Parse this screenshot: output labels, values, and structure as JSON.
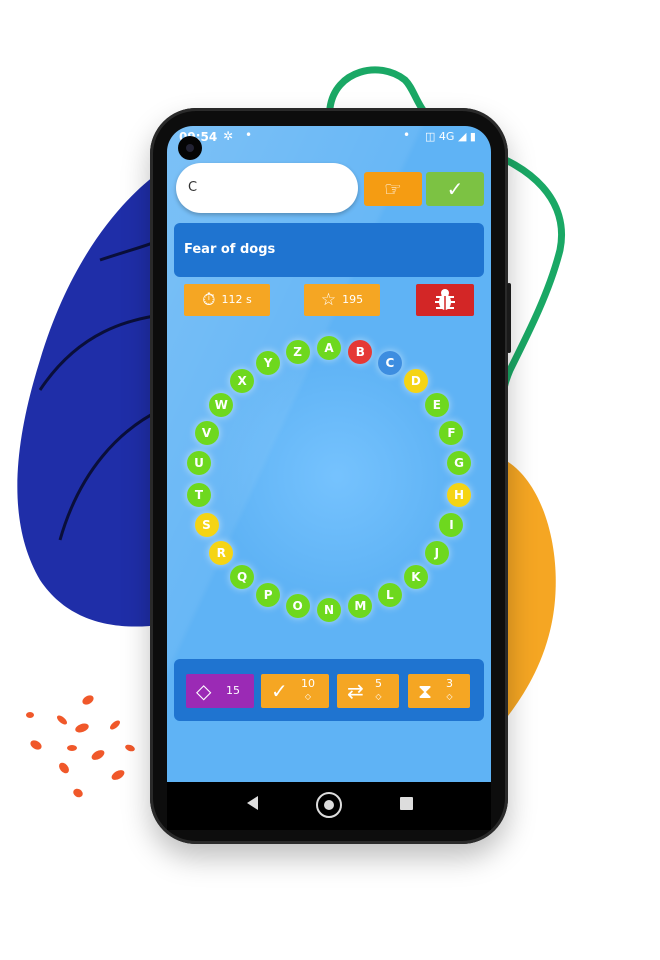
{
  "colors": {
    "screen_bg": "#5fb3f5",
    "panel_blue": "#1f74d0",
    "orange": "#f59c12",
    "green": "#7cc243",
    "red": "#d32626",
    "purple": "#9b2ab5",
    "letter_green": "#6ed81e",
    "letter_red": "#e53935",
    "letter_blue": "#3d8de0",
    "letter_yellow": "#f5d414"
  },
  "status_bar": {
    "time": "09:54",
    "left_icons": [
      "fan-icon",
      "dot"
    ],
    "right_icons": [
      "vibrate-icon",
      "network-4g",
      "signal-icon",
      "battery-icon"
    ],
    "network_label": "4G"
  },
  "answer_input": {
    "value": "C"
  },
  "hint_button": {
    "icon": "pointing-hand-icon"
  },
  "submit_button": {
    "icon": "check-icon"
  },
  "question": {
    "text": "Fear of dogs"
  },
  "stats": {
    "timer": {
      "icon": "stopwatch-icon",
      "value": "112 s"
    },
    "score": {
      "icon": "star-outline-icon",
      "value": "195"
    },
    "report": {
      "icon": "bug-icon"
    }
  },
  "letter_wheel": [
    {
      "letter": "A",
      "state": "default"
    },
    {
      "letter": "B",
      "state": "wrong"
    },
    {
      "letter": "C",
      "state": "current"
    },
    {
      "letter": "D",
      "state": "pending"
    },
    {
      "letter": "E",
      "state": "default"
    },
    {
      "letter": "F",
      "state": "default"
    },
    {
      "letter": "G",
      "state": "default"
    },
    {
      "letter": "H",
      "state": "pending"
    },
    {
      "letter": "I",
      "state": "default"
    },
    {
      "letter": "J",
      "state": "default"
    },
    {
      "letter": "K",
      "state": "default"
    },
    {
      "letter": "L",
      "state": "default"
    },
    {
      "letter": "M",
      "state": "default"
    },
    {
      "letter": "N",
      "state": "default"
    },
    {
      "letter": "O",
      "state": "default"
    },
    {
      "letter": "P",
      "state": "default"
    },
    {
      "letter": "Q",
      "state": "default"
    },
    {
      "letter": "R",
      "state": "pending"
    },
    {
      "letter": "S",
      "state": "pending"
    },
    {
      "letter": "T",
      "state": "default"
    },
    {
      "letter": "U",
      "state": "default"
    },
    {
      "letter": "V",
      "state": "default"
    },
    {
      "letter": "W",
      "state": "default"
    },
    {
      "letter": "X",
      "state": "default"
    },
    {
      "letter": "Y",
      "state": "default"
    },
    {
      "letter": "Z",
      "state": "default"
    }
  ],
  "powerups": {
    "gems": {
      "icon": "diamond-icon",
      "value": "15"
    },
    "reveal": {
      "icon": "check-icon",
      "cost": "10"
    },
    "swap": {
      "icon": "swap-arrows-icon",
      "cost": "5"
    },
    "time": {
      "icon": "hourglass-icon",
      "cost": "3"
    }
  },
  "nav_bar": {
    "icons": [
      "back-icon",
      "home-icon",
      "recents-icon"
    ]
  }
}
